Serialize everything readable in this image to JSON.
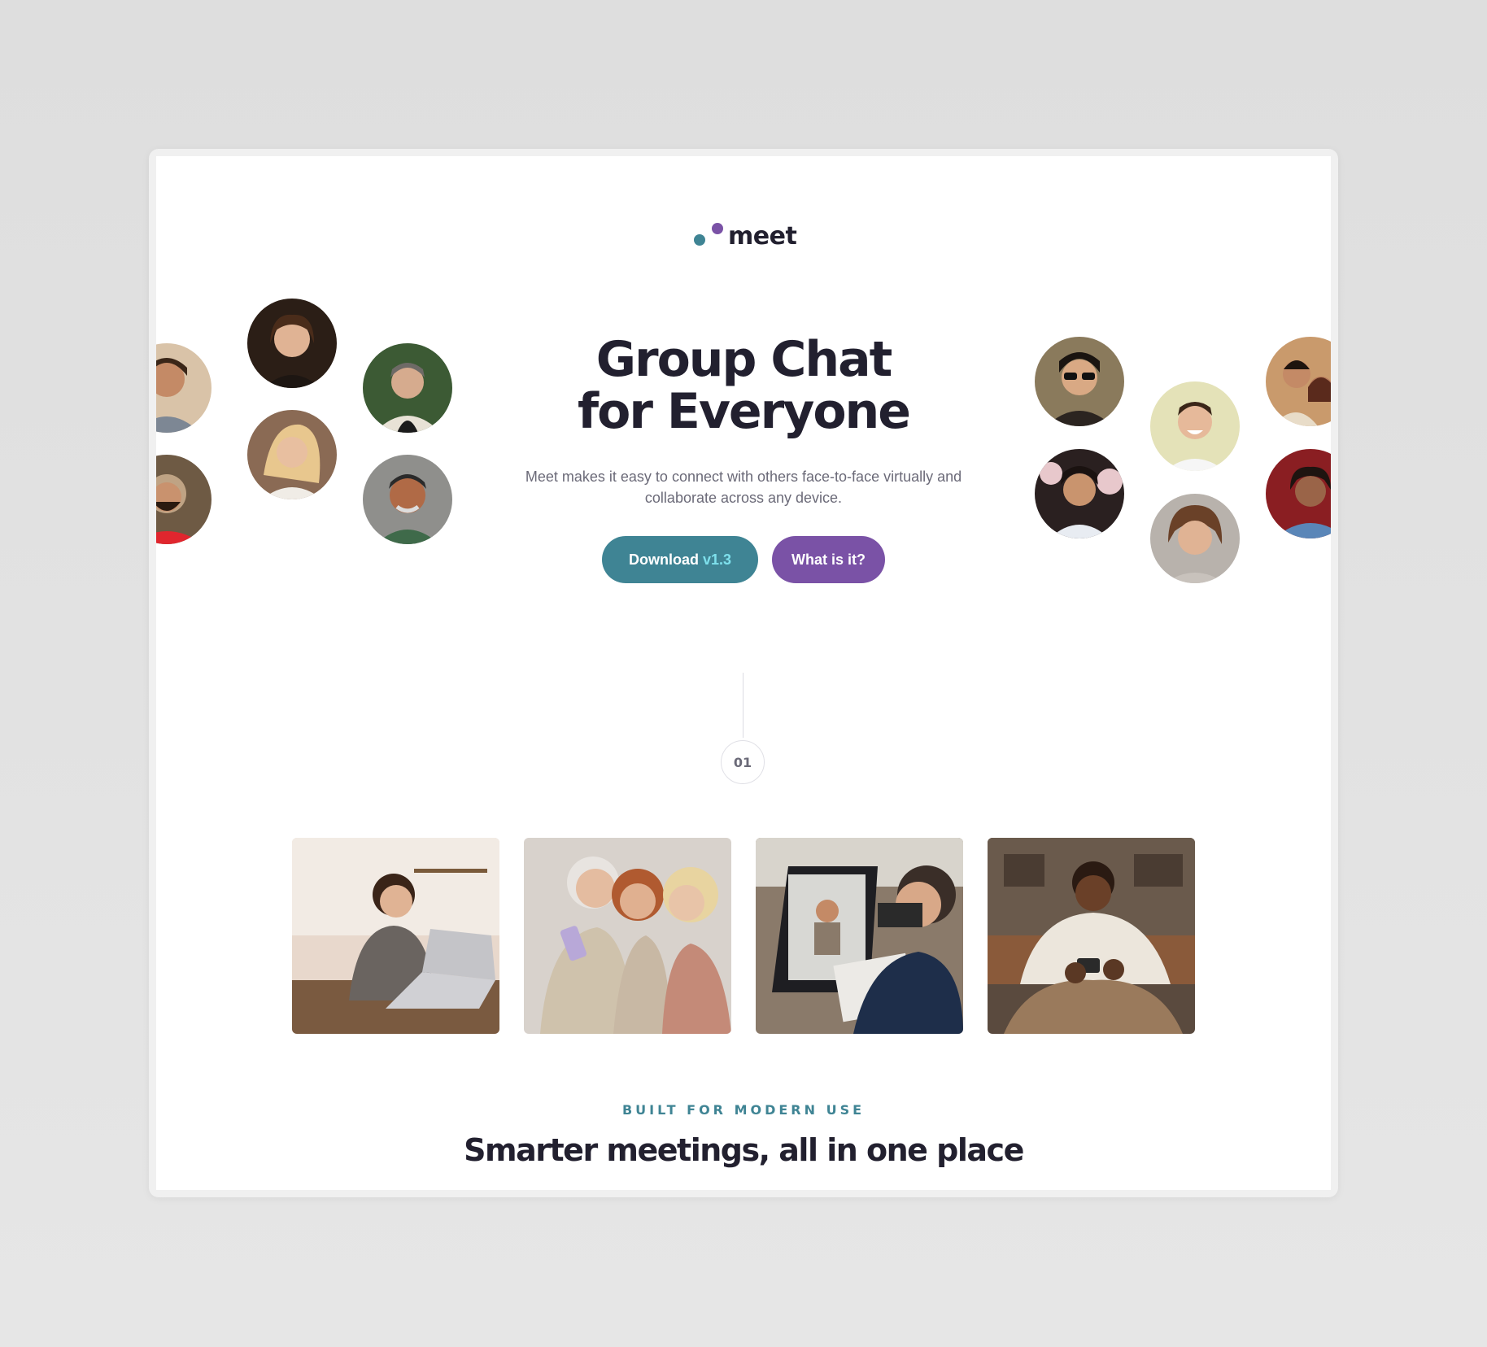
{
  "brand": {
    "name": "meet"
  },
  "hero": {
    "title_line1": "Group Chat",
    "title_line2": "for Everyone",
    "subtitle": "Meet makes it easy to connect with others face-to-face virtually and collaborate across any device.",
    "download_label": "Download",
    "download_version": "v1.3",
    "what_label": "What is it?"
  },
  "step": {
    "number": "01"
  },
  "features": {
    "eyebrow": "BUILT FOR MODERN USE",
    "title": "Smarter meetings, all in one place"
  },
  "colors": {
    "primary": "#3f8494",
    "accent": "#7a52a6",
    "heading": "#22202f",
    "text_muted": "#6b6a78"
  },
  "images": {
    "avatars": [
      "person-avatar",
      "person-avatar",
      "person-avatar",
      "person-avatar",
      "person-avatar",
      "person-avatar",
      "person-avatar",
      "person-avatar",
      "person-avatar",
      "person-avatar",
      "person-avatar",
      "person-avatar"
    ],
    "photos": [
      "woman-laptop-photo",
      "women-phone-photo",
      "video-call-photo",
      "man-phone-photo"
    ]
  }
}
